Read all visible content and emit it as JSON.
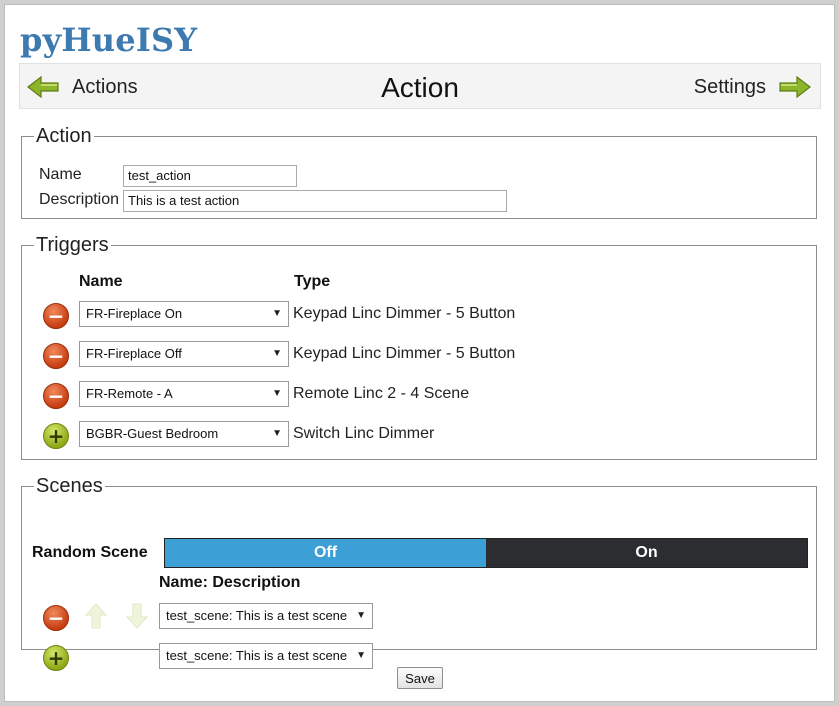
{
  "app": {
    "title": "pyHueISY"
  },
  "nav": {
    "back_label": "Actions",
    "title": "Action",
    "forward_label": "Settings"
  },
  "action": {
    "legend": "Action",
    "name_label": "Name",
    "name_value": "test_action",
    "description_label": "Description",
    "description_value": "This is a test action"
  },
  "triggers": {
    "legend": "Triggers",
    "col_name": "Name",
    "col_type": "Type",
    "rows": [
      {
        "button": "remove",
        "name": "FR-Fireplace On",
        "type": "Keypad Linc Dimmer - 5 Button"
      },
      {
        "button": "remove",
        "name": "FR-Fireplace Off",
        "type": "Keypad Linc Dimmer - 5 Button"
      },
      {
        "button": "remove",
        "name": "FR-Remote - A",
        "type": "Remote Linc 2 - 4 Scene"
      },
      {
        "button": "add",
        "name": "BGBR-Guest Bedroom",
        "type": "Switch Linc Dimmer"
      }
    ]
  },
  "scenes": {
    "legend": "Scenes",
    "random_label": "Random Scene",
    "toggle_off": "Off",
    "toggle_on": "On",
    "selected_state": "Off",
    "col_header": "Name: Description",
    "rows": [
      {
        "button": "remove",
        "value": "test_scene: This is a test scene"
      },
      {
        "button": "add",
        "value": "test_scene: This is a test scene"
      }
    ]
  },
  "save_label": "Save",
  "colors": {
    "title": "#3d7ab0",
    "toggle_off_bg": "#3c9fd6",
    "toggle_on_bg": "#2b2d30",
    "remove_button": "#c83d12",
    "add_button": "#8daa17",
    "nav_arrow": "#8db52a"
  },
  "icons": {
    "nav_back": "green-left-arrow-icon",
    "nav_forward": "green-right-arrow-icon",
    "remove": "red-minus-circle-icon",
    "add": "green-plus-circle-icon",
    "move_up": "up-arrow-icon",
    "move_down": "down-arrow-icon",
    "dropdown": "dropdown-caret-icon"
  }
}
